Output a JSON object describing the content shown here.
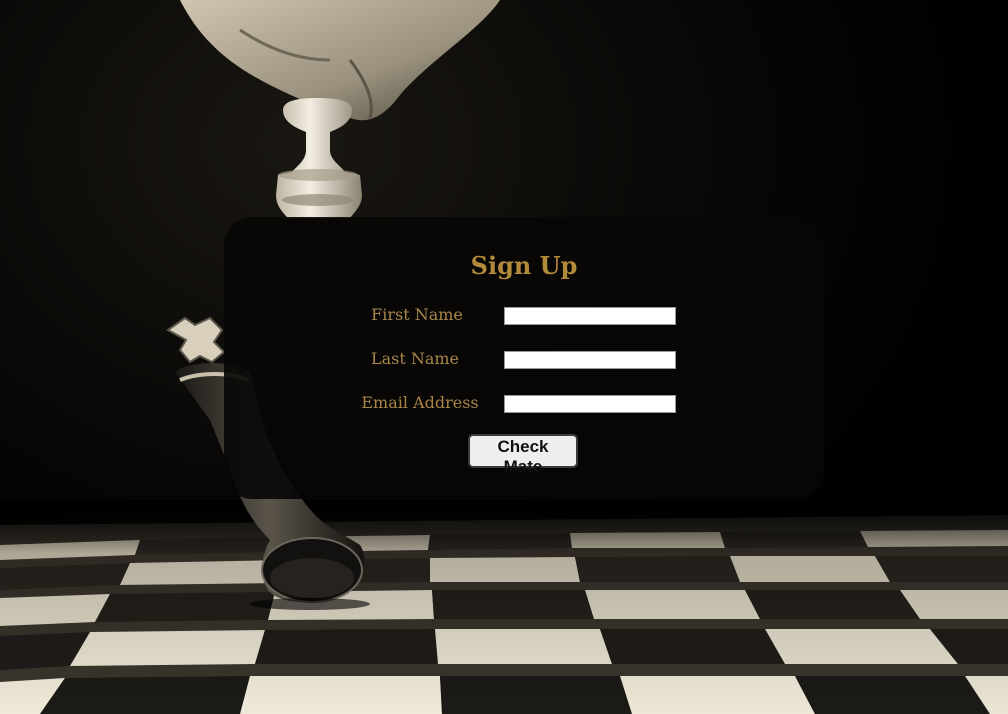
{
  "signup": {
    "title": "Sign Up",
    "fields": [
      {
        "label": "First Name",
        "value": ""
      },
      {
        "label": "Last Name",
        "value": ""
      },
      {
        "label": "Email Address",
        "value": ""
      }
    ],
    "submit_label": "Check Mate"
  },
  "colors": {
    "accent": "#b38a3a",
    "label": "#a8864a",
    "card_background": "#080705"
  },
  "background": {
    "subject": "chess-board-photo",
    "icons": [
      "white-chess-piece-in-hand",
      "toppled-black-king"
    ]
  }
}
